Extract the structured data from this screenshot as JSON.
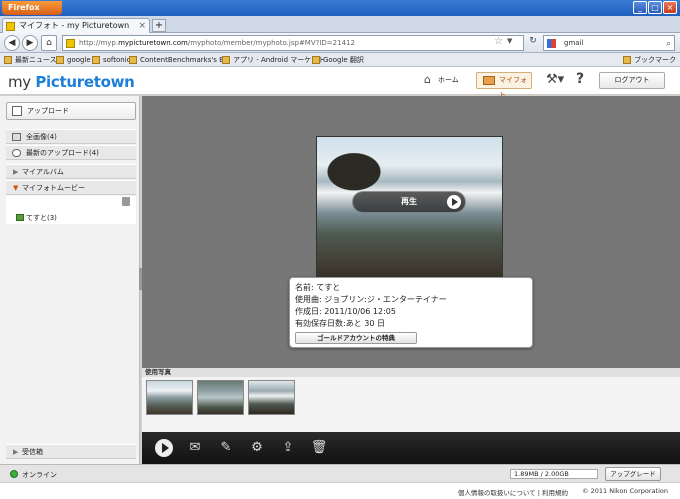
{
  "browser": {
    "menu_label": "Firefox",
    "tab_title": "マイフォト - my Picturetown",
    "url_prefix": "http://myp.",
    "url_domain": "mypicturetown.com",
    "url_rest": "/myphoto/member/myphoto.jsp#MV?ID=21412",
    "search_value": "gmail",
    "bookmarks": [
      "最新ニュース",
      "google",
      "softonic",
      "ContentBenchmarks's B...",
      "アプリ - Android マーケット",
      "Google 翻訳"
    ],
    "bookmarks_right": "ブックマーク"
  },
  "header": {
    "logo_my": "my ",
    "logo_brand": "Picturetown",
    "home_label": "ホーム",
    "myphoto_label": "マイフォト",
    "logout_label": "ログアウト"
  },
  "sidebar": {
    "upload_label": "アップロード",
    "all_images_label": "全画像(4)",
    "recent_upload_label": "最新のアップロード(4)",
    "my_album_label": "マイアルバム",
    "my_movie_label": "マイフォトムービー",
    "movie_item_label": "てすと(3)",
    "received_box_label": "受信箱"
  },
  "viewer": {
    "play_label": "再生",
    "info": {
      "name": "名前: てすと",
      "music": "使用曲: ジョプリン:ジ・エンターテイナー",
      "created": "作成日: 2011/10/06 12:05",
      "retention": "有効保存日数:あと 30 日",
      "gold_button": "ゴールドアカウントの特典"
    },
    "used_photos_label": "使用写真"
  },
  "status": {
    "online_label": "オンライン",
    "quota": "1.89MB / 2.00GB",
    "upgrade_label": "アップグレード"
  },
  "footer": {
    "links": "個人情報の取扱いについて  |  利用規約",
    "copyright": "© 2011 Nikon Corporation"
  }
}
